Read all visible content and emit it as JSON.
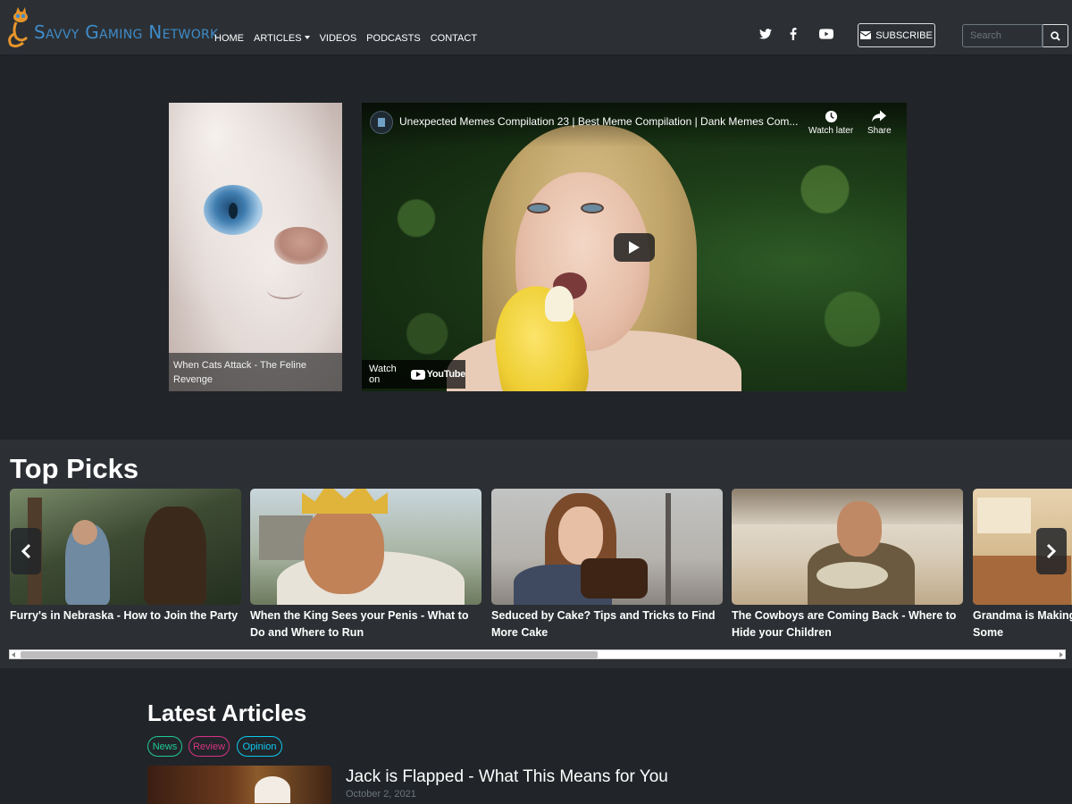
{
  "brand": {
    "name": "Savvy Gaming Network"
  },
  "nav": {
    "items": [
      {
        "label": "HOME"
      },
      {
        "label": "ARTICLES",
        "dropdown": true
      },
      {
        "label": "VIDEOS"
      },
      {
        "label": "PODCASTS"
      },
      {
        "label": "CONTACT"
      }
    ],
    "social_icons": [
      "twitter-icon",
      "facebook-icon",
      "youtube-icon"
    ],
    "subscribe_label": "SUBSCRIBE",
    "search_placeholder": "Search"
  },
  "hero": {
    "feature_caption": "When Cats Attack - The Feline Revenge",
    "video": {
      "title": "Unexpected Memes Compilation 23 | Best Meme Compilation | Dank Memes Com...",
      "watch_later": "Watch later",
      "share": "Share",
      "watch_on": "Watch on",
      "youtube": "YouTube"
    }
  },
  "top_picks": {
    "title": "Top Picks",
    "items": [
      {
        "title": "Furry's in Nebraska - How to Join the Party"
      },
      {
        "title": "When the King Sees your Penis - What to Do and Where to Run"
      },
      {
        "title": "Seduced by Cake? Tips and Tricks to Find More Cake"
      },
      {
        "title": "The Cowboys are Coming Back - Where to Hide your Children"
      },
      {
        "title": "Grandma is Making Cookies - Where to Get Some"
      }
    ]
  },
  "latest": {
    "title": "Latest Articles",
    "tags": [
      {
        "label": "News",
        "color": "#20c997"
      },
      {
        "label": "Review",
        "color": "#d63384"
      },
      {
        "label": "Opinion",
        "color": "#0dcaf0"
      }
    ],
    "articles": [
      {
        "title": "Jack is Flapped - What This Means for You",
        "date": "October 2, 2021"
      }
    ]
  },
  "colors": {
    "brand_blue": "#3f8bc9",
    "brand_orange": "#e8952b",
    "background": "#212529",
    "navbar": "#2c3034"
  }
}
